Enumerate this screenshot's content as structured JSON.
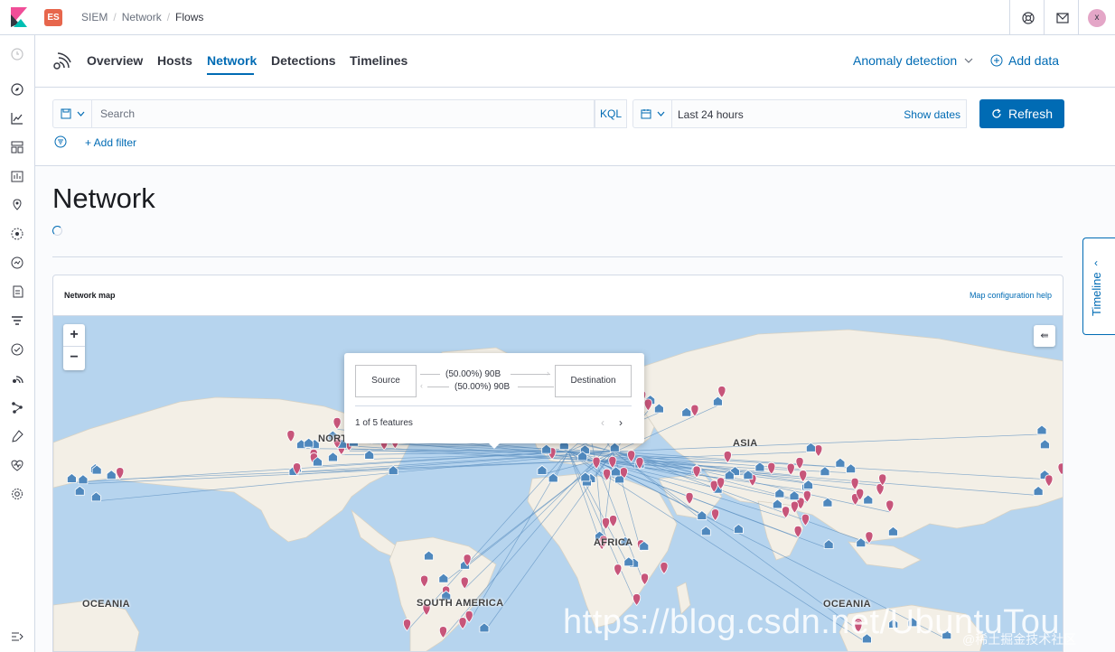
{
  "header": {
    "space_badge": "ES",
    "breadcrumbs": [
      "SIEM",
      "Network",
      "Flows"
    ],
    "avatar_initial": "x"
  },
  "tabs": {
    "items": [
      "Overview",
      "Hosts",
      "Network",
      "Detections",
      "Timelines"
    ],
    "active": "Network",
    "anomaly_detection": "Anomaly detection",
    "add_data": "Add data"
  },
  "query": {
    "search_placeholder": "Search",
    "language": "KQL",
    "date_range": "Last 24 hours",
    "show_dates": "Show dates",
    "refresh": "Refresh",
    "add_filter": "+ Add filter"
  },
  "page": {
    "title": "Network"
  },
  "timeline": {
    "label": "Timeline"
  },
  "map_panel": {
    "title": "Network map",
    "help_link": "Map configuration help",
    "continents": [
      "NORTH AMERICA",
      "ASIA",
      "AFRICA",
      "SOUTH AMERICA",
      "OCEANIA",
      "OCEANIA"
    ],
    "tooltip": {
      "source": "Source",
      "destination": "Destination",
      "flow_out": "(50.00%)  90B",
      "flow_in": "(50.00%)  90B",
      "feature_count": "1 of 5 features"
    }
  },
  "watermark": {
    "url": "https://blog.csdn.net/UbuntuTou",
    "community": "@稀土掘金技术社区"
  },
  "colors": {
    "primary": "#006bb4",
    "source_pin": "#c7557a",
    "destination_pin": "#4f88bd",
    "ocean": "#b6d4ee",
    "land": "#f3efe6"
  }
}
